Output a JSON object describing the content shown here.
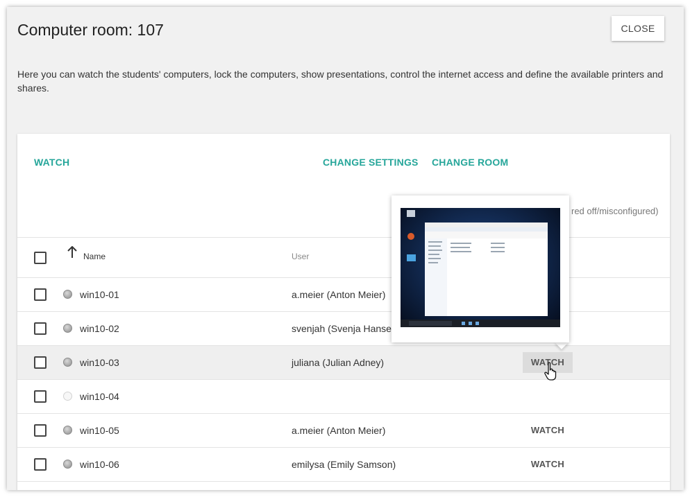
{
  "dialog": {
    "title": "Computer room: 107",
    "close_label": "CLOSE",
    "description": "Here you can watch the students' computers, lock the computers, show presentations, control the internet access and define the available printers and shares."
  },
  "actions": {
    "watch": "WATCH",
    "change_settings": "CHANGE SETTINGS",
    "change_room": "CHANGE ROOM"
  },
  "status_partial": "red off/misconfigured)",
  "table": {
    "columns": {
      "name": "Name",
      "user": "User"
    },
    "rows": [
      {
        "name": "win10-01",
        "user": "a.meier (Anton Meier)",
        "status": "online",
        "watch": ""
      },
      {
        "name": "win10-02",
        "user": "svenjah (Svenja Hansen)",
        "status": "online",
        "watch": ""
      },
      {
        "name": "win10-03",
        "user": "juliana (Julian Adney)",
        "status": "online",
        "watch": "WATCH"
      },
      {
        "name": "win10-04",
        "user": "",
        "status": "offline",
        "watch": ""
      },
      {
        "name": "win10-05",
        "user": "a.meier (Anton Meier)",
        "status": "online",
        "watch": "WATCH"
      },
      {
        "name": "win10-06",
        "user": "emilysa (Emily Samson)",
        "status": "online",
        "watch": "WATCH"
      }
    ]
  },
  "colors": {
    "accent": "#26a69a",
    "highlight_row": "#efefef",
    "dialog_bg": "#f1f1f1"
  },
  "icons": {
    "sort": "arrow-up-icon",
    "status": "status-dot-icon",
    "cursor": "hand-pointer-icon"
  }
}
